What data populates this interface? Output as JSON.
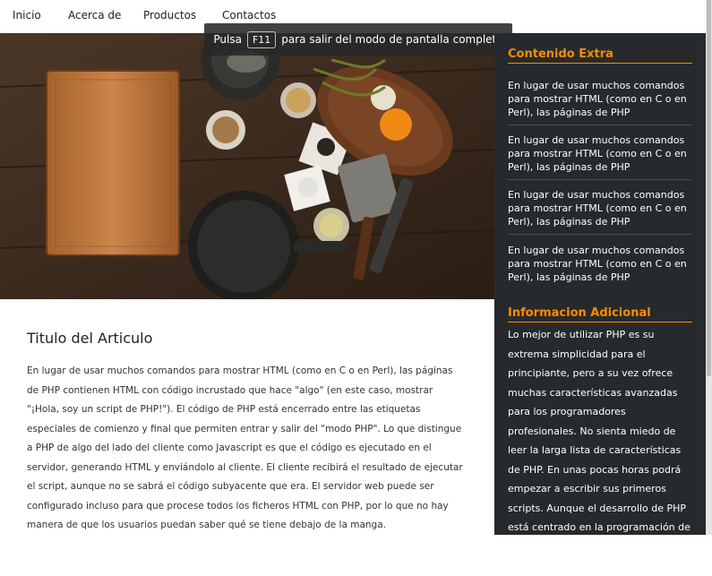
{
  "nav": {
    "items": [
      {
        "label": "Inicio"
      },
      {
        "label": "Acerca de"
      },
      {
        "label": "Productos"
      },
      {
        "label": "Contactos"
      }
    ]
  },
  "fullscreen_notice": {
    "before": "Pulsa",
    "key": "F11",
    "after": "para salir del modo de pantalla completa"
  },
  "sidebar": {
    "extra_title": "Contenido Extra",
    "extra_items": [
      {
        "text": "En lugar de usar muchos comandos para mostrar HTML (como en C o en Perl), las páginas de PHP"
      },
      {
        "text": "En lugar de usar muchos comandos para mostrar HTML (como en C o en Perl), las páginas de PHP"
      },
      {
        "text": "En lugar de usar muchos comandos para mostrar HTML (como en C o en Perl), las páginas de PHP"
      },
      {
        "text": "En lugar de usar muchos comandos para mostrar HTML (como en C o en Perl), las páginas de PHP"
      }
    ],
    "info_title": "Informacion Adicional",
    "info_text": "Lo mejor de utilizar PHP es su extrema simplicidad para el principiante, pero a su vez ofrece muchas características avanzadas para los programadores profesionales. No sienta miedo de leer la larga lista de características de PHP. En unas pocas horas podrá empezar a escribir sus primeros scripts. Aunque el desarrollo de PHP está centrado en la programación de scripts del lado del servidor, se puede utilizar para muchas"
  },
  "article": {
    "title": "Titulo del Articulo",
    "body": "En lugar de usar muchos comandos para mostrar HTML (como en C o en Perl), las páginas de PHP contienen HTML con código incrustado que hace \"algo\" (en este caso, mostrar \"¡Hola, soy un script de PHP!\"). El código de PHP está encerrado entre las etiquetas especiales de comienzo y final que permiten entrar y salir del \"modo PHP\". Lo que distingue a PHP de algo del lado del cliente como Javascript es que el código es ejecutado en el servidor, generando HTML y enviándolo al cliente. El cliente recibirá el resultado de ejecutar el script, aunque no se sabrá el código subyacente que era. El servidor web puede ser configurado incluso para que procese todos los ficheros HTML con PHP, por lo que no hay manera de que los usuarios puedan saber qué se tiene debajo de la manga."
  },
  "colors": {
    "accent": "#ff8a00",
    "sidebar_bg": "#262a2c"
  }
}
